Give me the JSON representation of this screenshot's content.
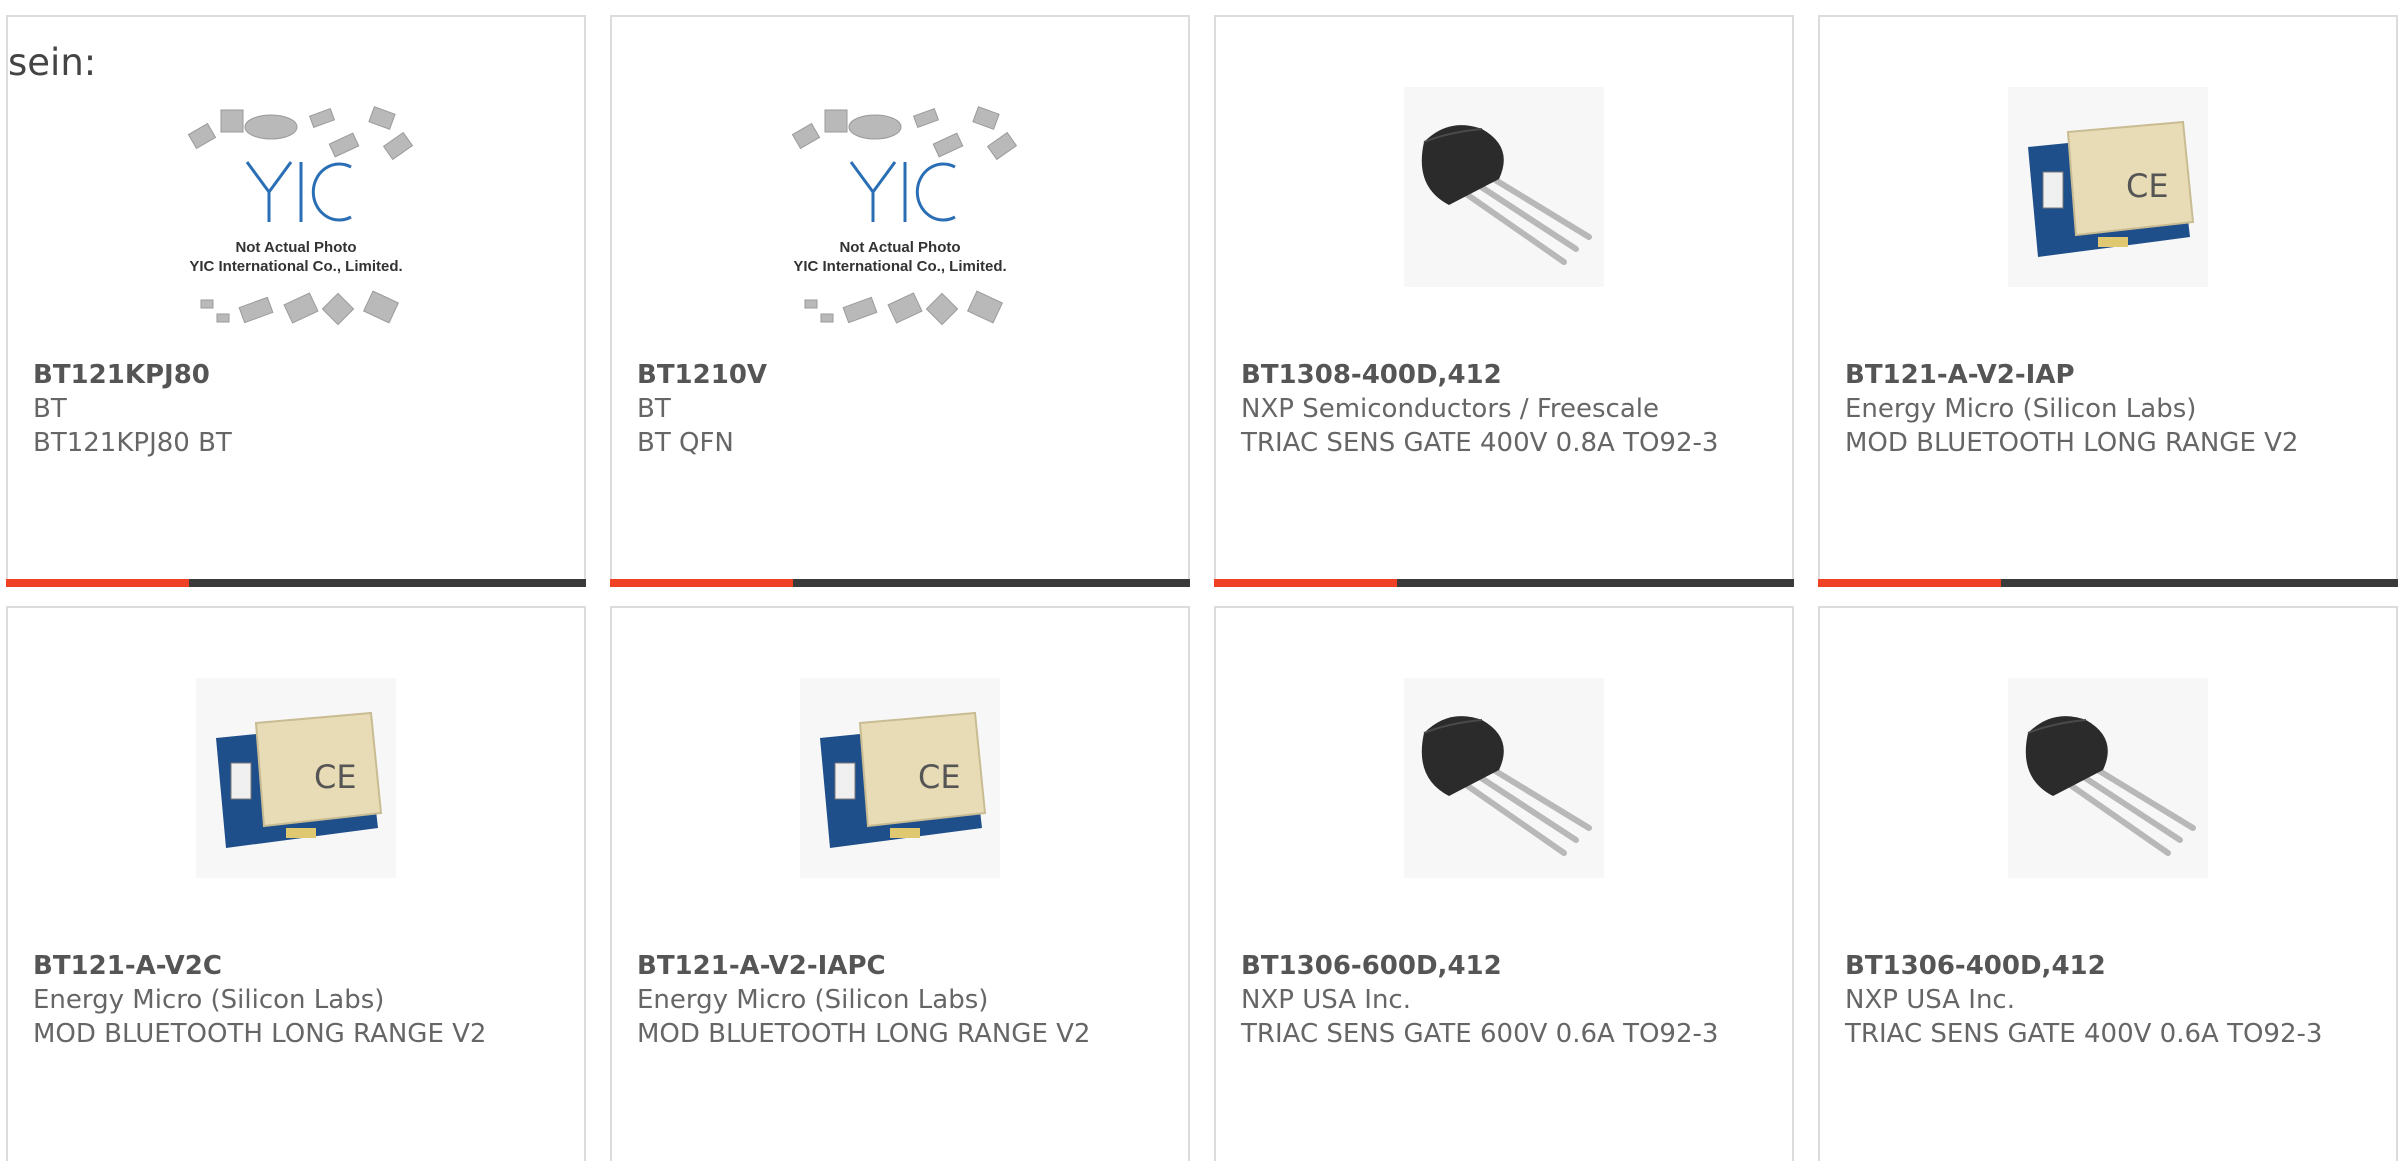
{
  "intro_text": "sein:",
  "products": [
    {
      "part_number": "BT121KPJ80",
      "manufacturer": "BT",
      "description": "BT121KPJ80 BT",
      "image_type": "placeholder",
      "placeholder_caption_1": "Not Actual Photo",
      "placeholder_caption_2": "YIC International Co., Limited.",
      "placeholder_logo": "YIC"
    },
    {
      "part_number": "BT1210V",
      "manufacturer": "BT",
      "description": "BT QFN",
      "image_type": "placeholder",
      "placeholder_caption_1": "Not Actual Photo",
      "placeholder_caption_2": "YIC International Co., Limited.",
      "placeholder_logo": "YIC"
    },
    {
      "part_number": "BT1308-400D,412",
      "manufacturer": "NXP Semiconductors / Freescale",
      "description": "TRIAC SENS GATE 400V 0.8A TO92-3",
      "image_type": "to92-transistor-icon"
    },
    {
      "part_number": "BT121-A-V2-IAP",
      "manufacturer": "Energy Micro (Silicon Labs)",
      "description": "MOD BLUETOOTH LONG RANGE V2",
      "image_type": "bluetooth-module-icon"
    },
    {
      "part_number": "BT121-A-V2C",
      "manufacturer": "Energy Micro (Silicon Labs)",
      "description": "MOD BLUETOOTH LONG RANGE V2",
      "image_type": "bluetooth-module-icon"
    },
    {
      "part_number": "BT121-A-V2-IAPC",
      "manufacturer": "Energy Micro (Silicon Labs)",
      "description": "MOD BLUETOOTH LONG RANGE V2",
      "image_type": "bluetooth-module-icon"
    },
    {
      "part_number": "BT1306-600D,412",
      "manufacturer": "NXP USA Inc.",
      "description": "TRIAC SENS GATE 600V 0.6A TO92-3",
      "image_type": "to92-transistor-icon"
    },
    {
      "part_number": "BT1306-400D,412",
      "manufacturer": "NXP USA Inc.",
      "description": "TRIAC SENS GATE 400V 0.6A TO92-3",
      "image_type": "to92-transistor-icon"
    }
  ],
  "colors": {
    "accent": "#ef4123",
    "bar_dark": "#3a3a3a",
    "card_border": "#dcdcdc",
    "text": "#666666",
    "pcb_blue": "#1f4f8a",
    "shield_beige": "#e8dcb6",
    "transistor_body": "#2b2b2b",
    "logo_blue": "#2a6fb5"
  }
}
